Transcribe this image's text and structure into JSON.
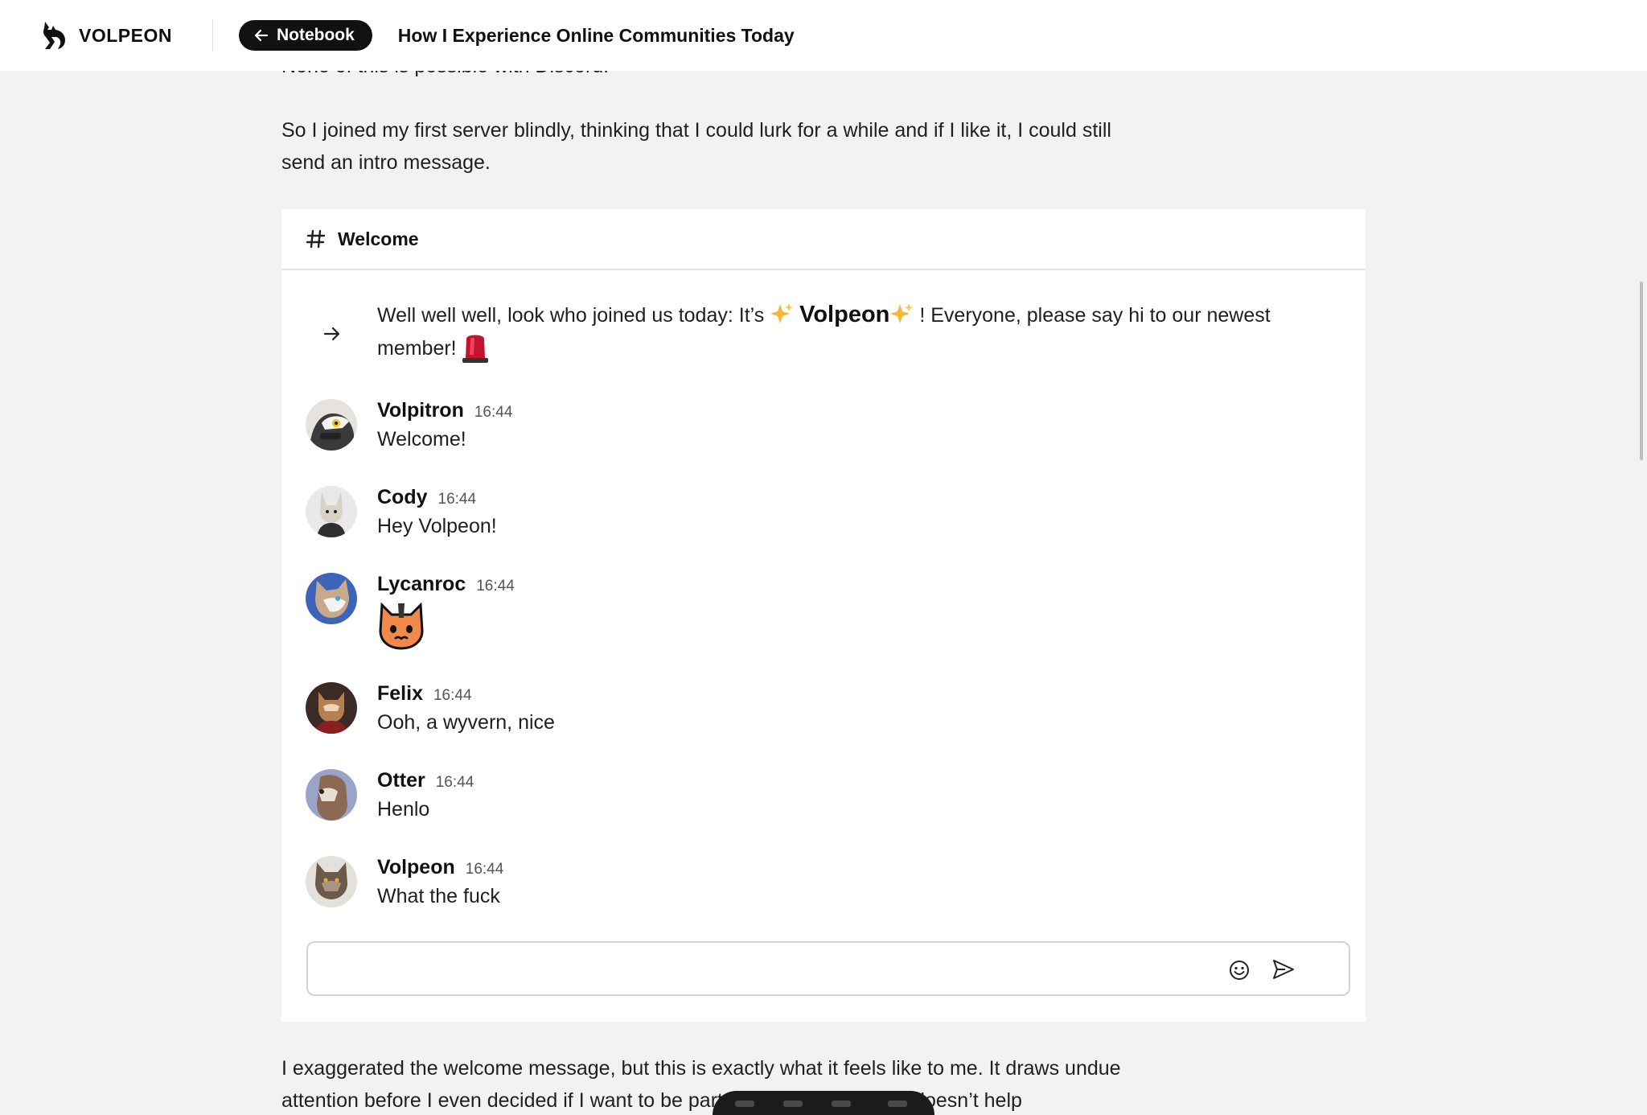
{
  "header": {
    "brand_name": "VOLPEON",
    "back_button_label": "Notebook",
    "page_title": "How I Experience Online Communities Today"
  },
  "article": {
    "cut_paragraph": "None of this is possible with Discord.",
    "paragraph_1": "So I joined my first server blindly, thinking that I could lurk for a while and if I like it, I could still send an intro message.",
    "paragraph_2": "I exaggerated the welcome message, but this is exactly what it feels like to me. It draws undue attention before I even decided if I want to be part of that community. It doesn’t help"
  },
  "chat": {
    "channel_name": "Welcome",
    "system_message": {
      "before": "Well well well, look who joined us today: It’s ",
      "highlighted_name": "Volpeon",
      "after": "! Everyone, please say hi to our newest member!"
    },
    "messages": [
      {
        "author": "Volpitron",
        "time": "16:44",
        "text": "Welcome!"
      },
      {
        "author": "Cody",
        "time": "16:44",
        "text": "Hey Volpeon!"
      },
      {
        "author": "Lycanroc",
        "time": "16:44",
        "text": "",
        "emote": "cat-face-emote"
      },
      {
        "author": "Felix",
        "time": "16:44",
        "text": "Ooh, a wyvern, nice"
      },
      {
        "author": "Otter",
        "time": "16:44",
        "text": "Henlo"
      },
      {
        "author": "Volpeon",
        "time": "16:44",
        "text": "What the fuck"
      }
    ],
    "composer": {
      "placeholder": ""
    }
  },
  "icons": {
    "brand": "dragon-logo-icon",
    "back": "arrow-left-icon",
    "channel": "hash-icon",
    "system": "arrow-right-icon",
    "sparkles": "sparkles-emoji",
    "siren": "siren-emoji",
    "emoji_picker": "smiley-icon",
    "send": "send-icon"
  },
  "colors": {
    "page_background": "#f2f2f2",
    "card_background": "#ffffff",
    "button_dark": "#111111",
    "text": "#1f1f1f"
  }
}
